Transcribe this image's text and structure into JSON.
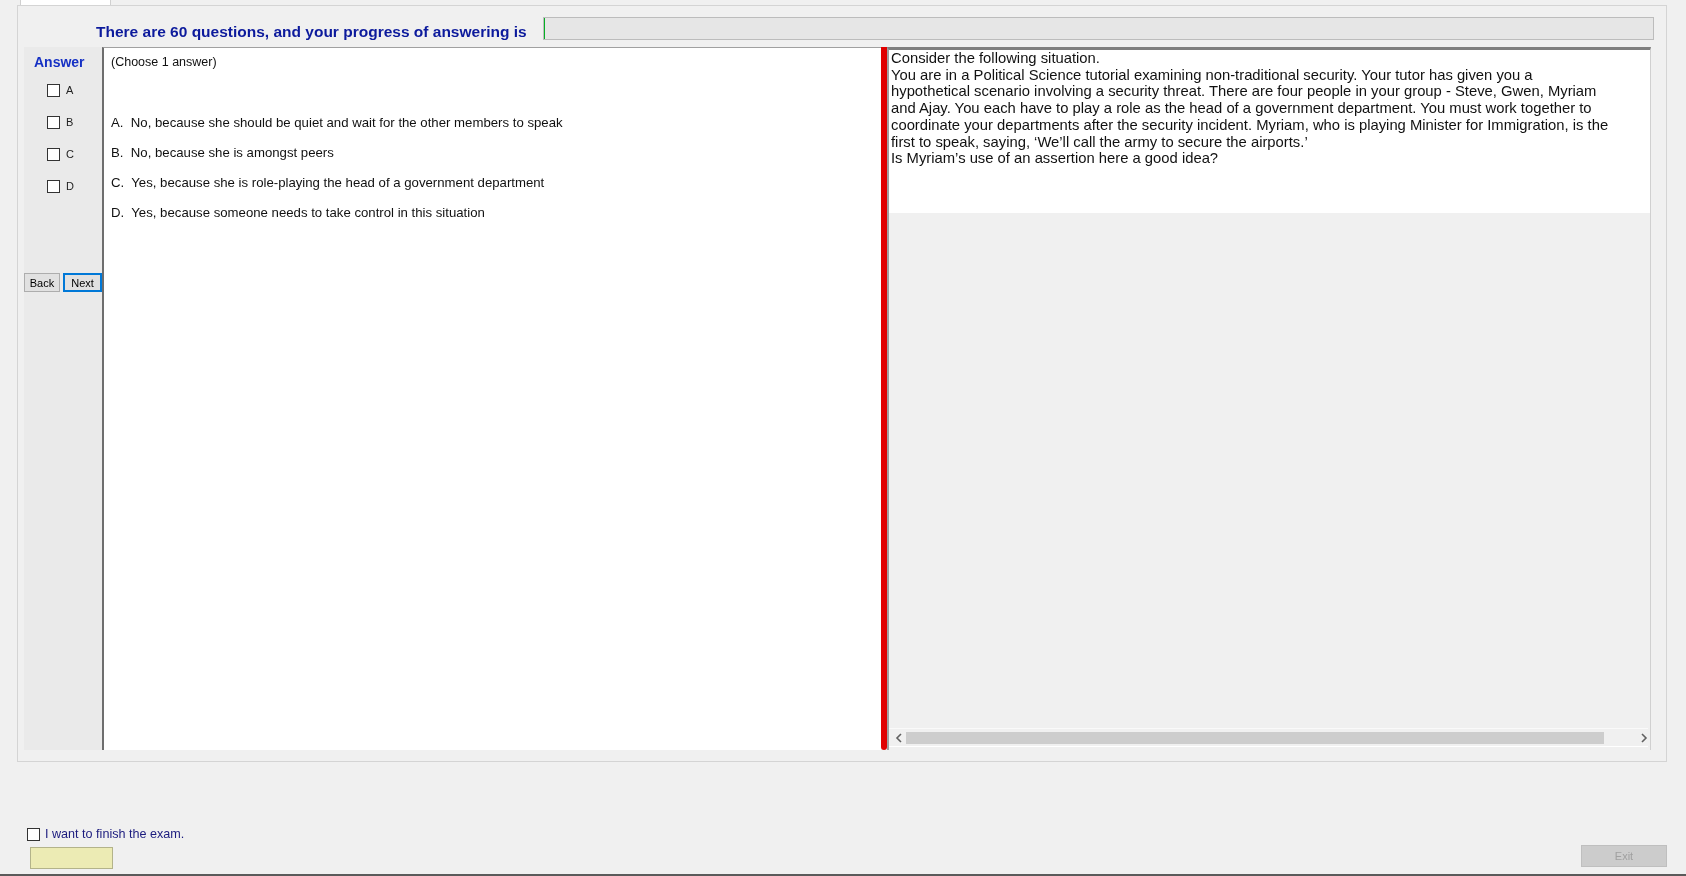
{
  "header": {
    "text": "There are 60 questions, and your progress of answering is",
    "progress": {
      "level": 0
    }
  },
  "answer_panel": {
    "title": "Answer",
    "choices": [
      {
        "label": "A",
        "checked": false
      },
      {
        "label": "B",
        "checked": false
      },
      {
        "label": "C",
        "checked": false
      },
      {
        "label": "D",
        "checked": false
      }
    ],
    "buttons": [
      {
        "label": "Back",
        "focused": false
      },
      {
        "label": "Next",
        "focused": true
      }
    ]
  },
  "question": {
    "instruction": "(Choose 1 answer)",
    "options": [
      "A.  No, because she should be quiet and wait for the other members to speak",
      "B.  No, because she is amongst peers",
      "C.  Yes, because she is role-playing the head of a government department",
      "D.  Yes, because someone needs to take control in this situation"
    ]
  },
  "passage": {
    "paragraphs": [
      "Consider the following situation.",
      "You are in a Political Science tutorial examining non-traditional security. Your tutor has given you a hypothetical scenario involving a security threat. There are four people in your group - Steve, Gwen, Myriam and Ajay. You each have to play a role as the head of a government department. You must work together to coordinate your departments after the security incident. Myriam, who is playing Minister for Immigration, is the first to speak, saying, ‘We’ll call the army to secure the airports.’",
      "Is Myriam’s use of an assertion here a good idea?"
    ]
  },
  "footer": {
    "finish_checkbox": {
      "label": "I want to finish the exam.",
      "checked": false
    },
    "exit_button": {
      "label": "Exit",
      "disabled": true
    }
  }
}
